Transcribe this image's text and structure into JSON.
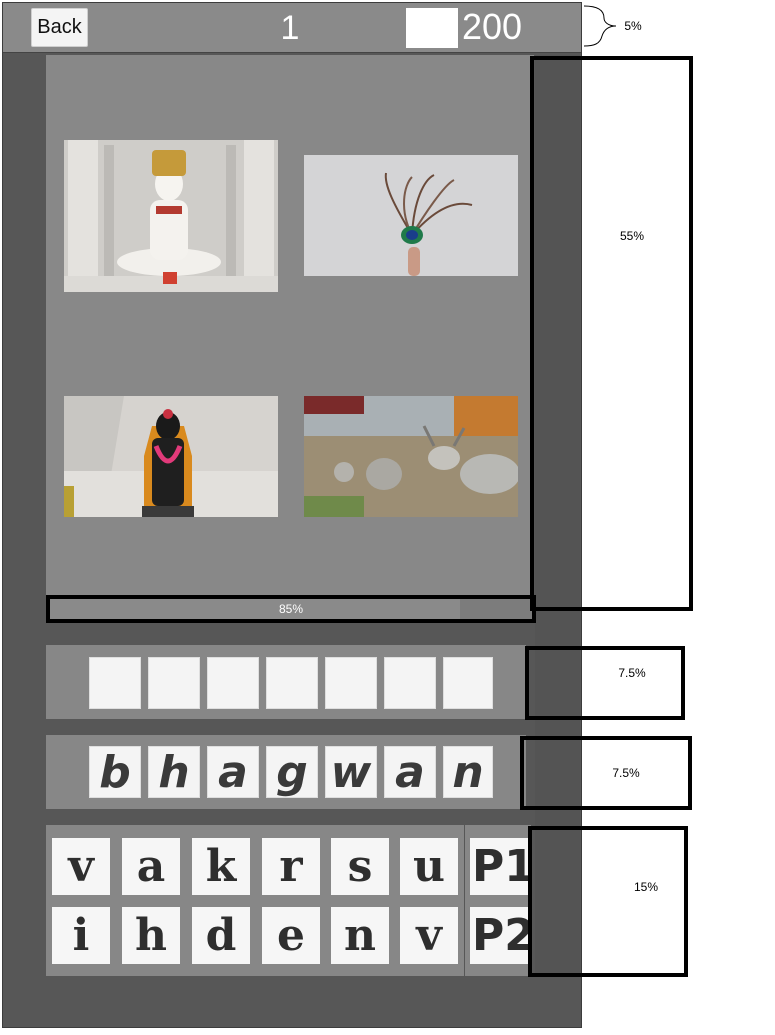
{
  "header": {
    "back_label": "Back",
    "level": "1",
    "coins": "200"
  },
  "pictures": [
    {
      "name": "jain-idol-picture"
    },
    {
      "name": "peacock-feather-picture"
    },
    {
      "name": "black-deity-picture"
    },
    {
      "name": "cattle-picture"
    }
  ],
  "progress": {
    "label": "85%",
    "value_percent": 85
  },
  "answer": {
    "slots": [
      "",
      "",
      "",
      "",
      "",
      "",
      ""
    ]
  },
  "hint": {
    "letters": [
      "b",
      "h",
      "a",
      "g",
      "w",
      "a",
      "n"
    ]
  },
  "keyboard": {
    "row1": [
      "v",
      "a",
      "k",
      "r",
      "s",
      "u"
    ],
    "row2": [
      "i",
      "h",
      "d",
      "e",
      "n",
      "v"
    ],
    "powerups": [
      "P1",
      "P2"
    ]
  },
  "annotations": {
    "top_bar": "5%",
    "images": "55%",
    "answer_row": "7.5%",
    "hint_row": "7.5%",
    "keyboard": "15%"
  },
  "colors": {
    "frame": "#575757",
    "panel": "#888888",
    "tile": "#f4f4f4"
  }
}
